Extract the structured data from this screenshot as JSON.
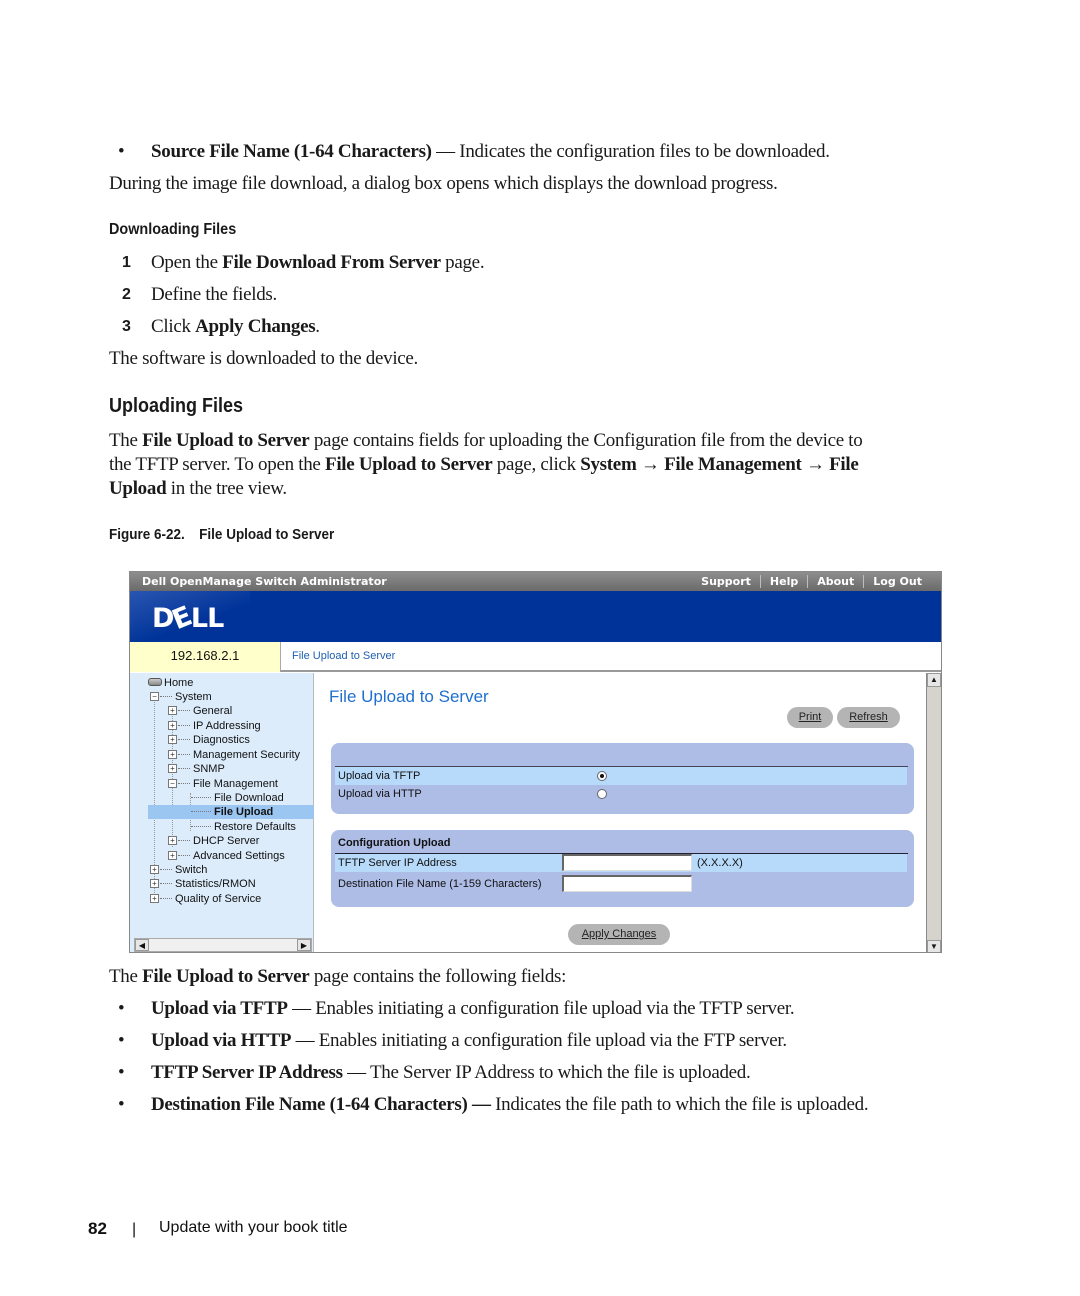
{
  "intro": {
    "bullet_source_bold": "Source File Name (1-64 Characters)",
    "bullet_source_rest": " — Indicates the configuration files to be downloaded.",
    "download_note": "During the image file download, a dialog box opens which displays the download progress."
  },
  "downloading": {
    "heading": "Downloading Files",
    "steps": [
      {
        "num": "1",
        "pre": "Open the ",
        "bold": "File Download From Server",
        "post": " page."
      },
      {
        "num": "2",
        "pre": "Define the fields.",
        "bold": "",
        "post": ""
      },
      {
        "num": "3",
        "pre": "Click ",
        "bold": "Apply Changes",
        "post": "."
      }
    ],
    "result": "The software is downloaded to the device."
  },
  "uploading": {
    "heading": "Uploading Files",
    "p1_a": "The ",
    "p1_b": "File Upload to Server",
    "p1_c": " page contains fields for uploading the Configuration file from the device to",
    "p2_a": "the TFTP server. To open the ",
    "p2_b": "File Upload to Server",
    "p2_c": " page, click ",
    "p2_d": "System",
    "p2_e": " → ",
    "p2_f": "File Management",
    "p2_g": " → ",
    "p2_h": "File",
    "p3_a": "Upload",
    "p3_b": " in the tree view."
  },
  "figure": {
    "label": "Figure 6-22.",
    "title": "File Upload to Server"
  },
  "screenshot": {
    "app_title": "Dell OpenManage Switch Administrator",
    "top_links": [
      "Support",
      "Help",
      "About",
      "Log Out"
    ],
    "logo": {
      "d": "D",
      "e": "E",
      "ll": "LL"
    },
    "ip": "192.168.2.1",
    "breadcrumb": "File Upload to Server",
    "tree": [
      {
        "label": "Home",
        "level": 0,
        "expander": "home"
      },
      {
        "label": "System",
        "level": 1,
        "expander": "−"
      },
      {
        "label": "General",
        "level": 2,
        "expander": "+"
      },
      {
        "label": "IP Addressing",
        "level": 2,
        "expander": "+"
      },
      {
        "label": "Diagnostics",
        "level": 2,
        "expander": "+"
      },
      {
        "label": "Management Security",
        "level": 2,
        "expander": "+"
      },
      {
        "label": "SNMP",
        "level": 2,
        "expander": "+"
      },
      {
        "label": "File Management",
        "level": 2,
        "expander": "−"
      },
      {
        "label": "File Download",
        "level": 3,
        "expander": ""
      },
      {
        "label": "File Upload",
        "level": 3,
        "expander": "",
        "selected": true
      },
      {
        "label": "Restore Defaults",
        "level": 3,
        "expander": ""
      },
      {
        "label": "DHCP Server",
        "level": 2,
        "expander": "+"
      },
      {
        "label": "Advanced Settings",
        "level": 2,
        "expander": "+"
      },
      {
        "label": "Switch",
        "level": 1,
        "expander": "+"
      },
      {
        "label": "Statistics/RMON",
        "level": 1,
        "expander": "+"
      },
      {
        "label": "Quality of Service",
        "level": 1,
        "expander": "+"
      }
    ],
    "page_title": "File Upload to Server",
    "print_label": "Print",
    "refresh_label": "Refresh",
    "upload_options": [
      {
        "label": "Upload via TFTP",
        "selected": true
      },
      {
        "label": "Upload via HTTP",
        "selected": false
      }
    ],
    "config_section": {
      "title": "Configuration Upload",
      "fields": [
        {
          "label": "TFTP Server IP Address",
          "value": "",
          "hint": "(X.X.X.X)"
        },
        {
          "label": "Destination File Name (1-159 Characters)",
          "value": "",
          "hint": ""
        }
      ]
    },
    "apply_label": "Apply Changes",
    "colors": {
      "banner": "#003399",
      "ip_bg": "#ffffcc",
      "tree_bg": "#dcecfb",
      "panel": "#aebde6",
      "row_highlight": "#b7dafa",
      "title_blue": "#1f6fcf"
    }
  },
  "fields_intro": {
    "a": "The ",
    "b": "File Upload to Server",
    "c": " page contains the following fields:"
  },
  "field_bullets": [
    {
      "bold": "Upload via TFTP",
      "rest": " — Enables initiating a configuration file upload via the TFTP server."
    },
    {
      "bold": "Upload via HTTP",
      "rest": " — Enables initiating a configuration file upload via the FTP server."
    },
    {
      "bold": "TFTP Server IP Address",
      "rest": " — The Server IP Address to which the file is uploaded."
    },
    {
      "bold": "Destination File Name (1-64 Characters) —",
      "rest": " Indicates the file path to which the file is uploaded."
    }
  ],
  "footer": {
    "page_number": "82",
    "separator": "|",
    "book_title": "Update with your book title"
  }
}
